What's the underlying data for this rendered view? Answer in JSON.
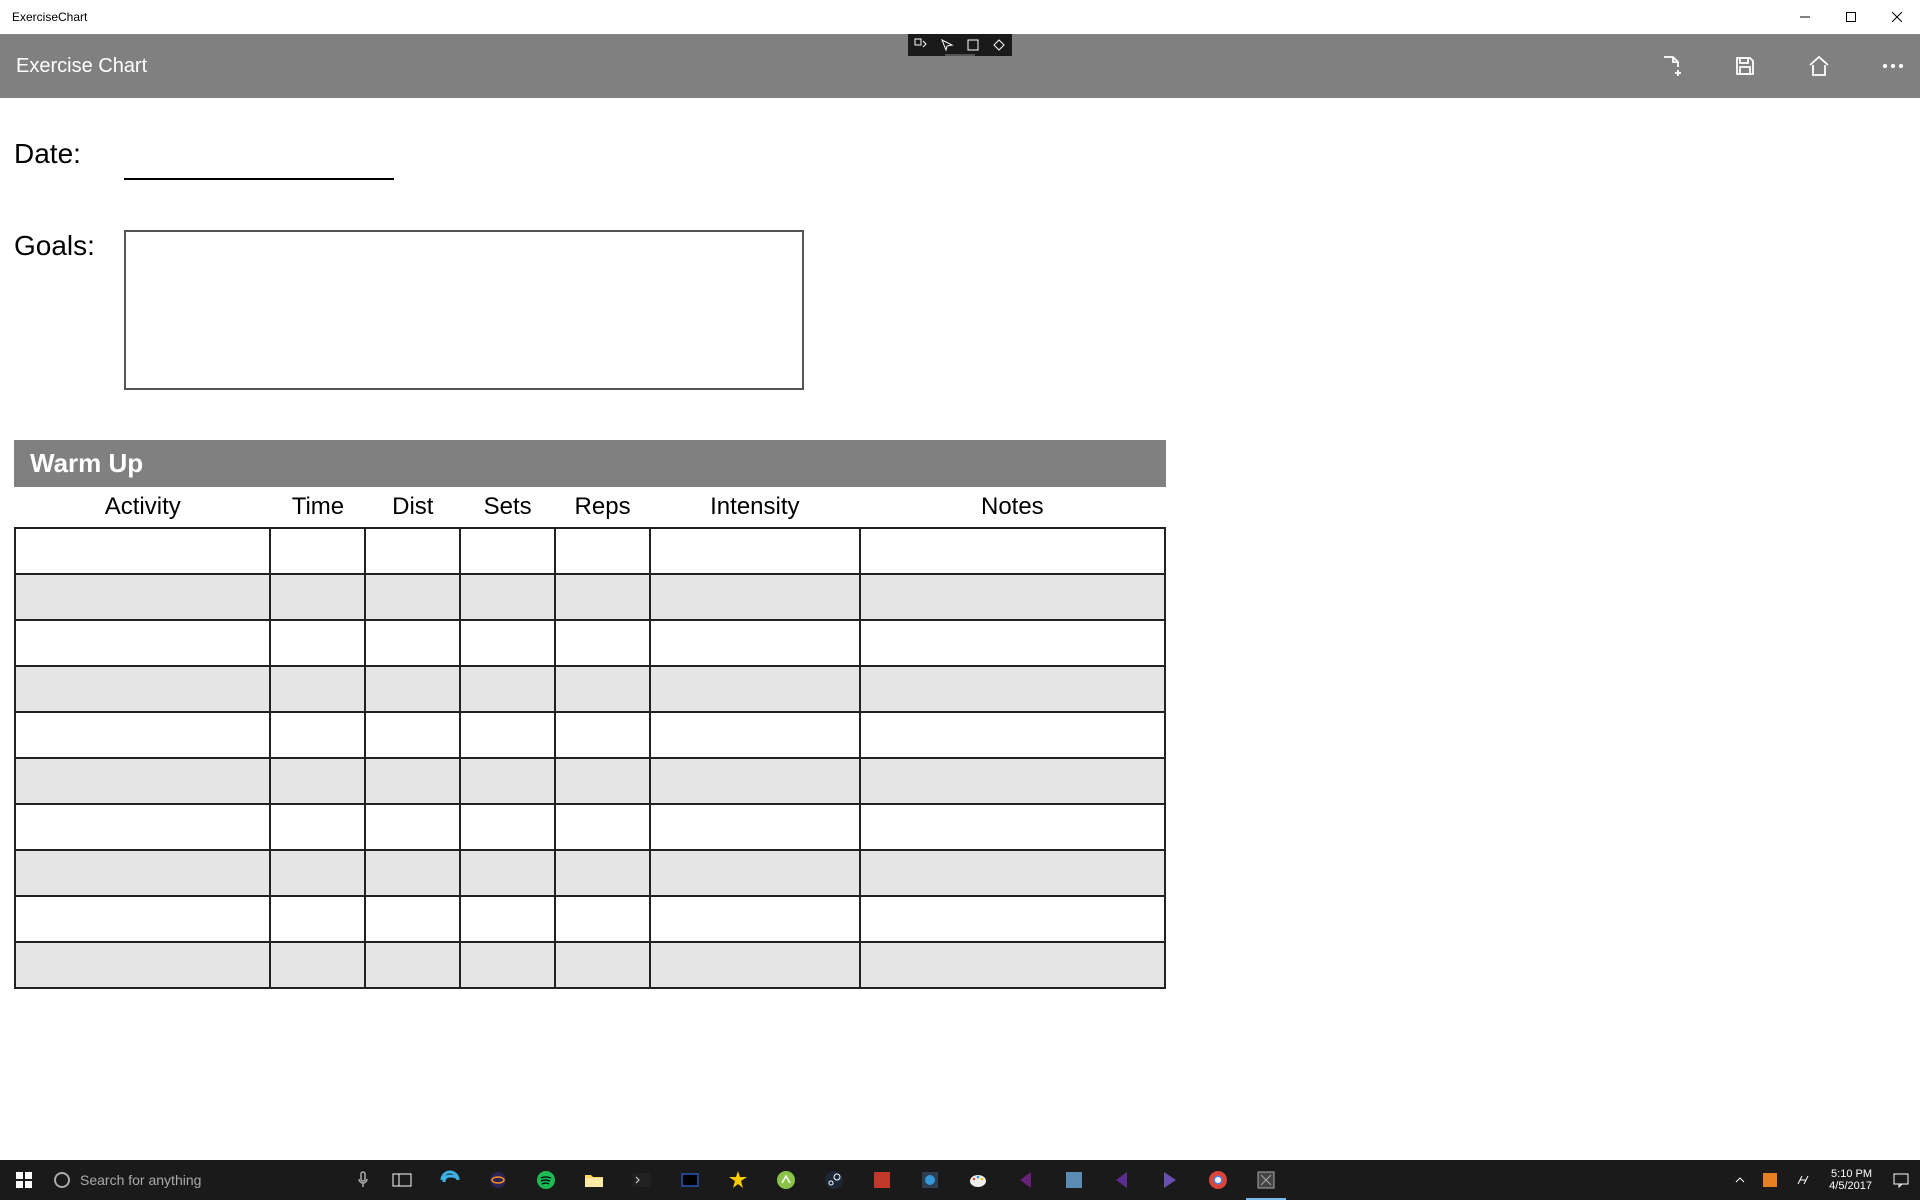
{
  "window": {
    "title": "ExerciseChart"
  },
  "appbar": {
    "title": "Exercise Chart"
  },
  "fields": {
    "date_label": "Date:",
    "goals_label": "Goals:"
  },
  "warmup": {
    "title": "Warm Up",
    "columns": {
      "activity": "Activity",
      "time": "Time",
      "dist": "Dist",
      "sets": "Sets",
      "reps": "Reps",
      "intensity": "Intensity",
      "notes": "Notes"
    },
    "row_count": 10
  },
  "taskbar": {
    "search_placeholder": "Search for anything",
    "clock_time": "5:10 PM",
    "clock_date": "4/5/2017"
  }
}
